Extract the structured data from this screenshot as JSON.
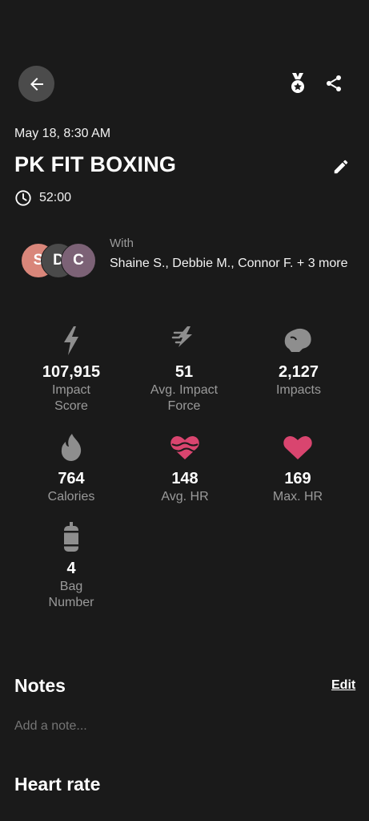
{
  "header": {
    "back_icon": "arrow-left-icon",
    "medal_icon": "medal-icon",
    "share_icon": "share-icon"
  },
  "workout": {
    "date": "May 18, 8:30 AM",
    "title": "PK FIT BOXING",
    "duration": "52:00",
    "edit_icon": "pencil-icon",
    "clock_icon": "clock-icon"
  },
  "participants": {
    "avatars": [
      {
        "initial": "S",
        "color": "#d9867a"
      },
      {
        "initial": "D",
        "color": "#4a4a4a"
      },
      {
        "initial": "C",
        "color": "#7c6276"
      }
    ],
    "with_label": "With",
    "names": "Shaine  S., Debbie M., Connor F. + 3 more"
  },
  "stats": [
    {
      "icon": "lightning-icon",
      "value": "107,915",
      "label": "Impact Score"
    },
    {
      "icon": "force-icon",
      "value": "51",
      "label": "Avg. Impact Force"
    },
    {
      "icon": "boxing-glove-icon",
      "value": "2,127",
      "label": "Impacts"
    },
    {
      "icon": "flame-icon",
      "value": "764",
      "label": "Calories"
    },
    {
      "icon": "heart-wave-icon",
      "value": "148",
      "label": "Avg. HR"
    },
    {
      "icon": "heart-icon",
      "value": "169",
      "label": "Max. HR"
    },
    {
      "icon": "punching-bag-icon",
      "value": "4",
      "label": "Bag Number"
    }
  ],
  "colors": {
    "background": "#1a1a1a",
    "icon_gray": "#8e8e8e",
    "heart_pink": "#d9456f"
  },
  "notes": {
    "heading": "Notes",
    "edit_label": "Edit",
    "placeholder": "Add a note..."
  },
  "heart_rate": {
    "heading": "Heart rate"
  }
}
